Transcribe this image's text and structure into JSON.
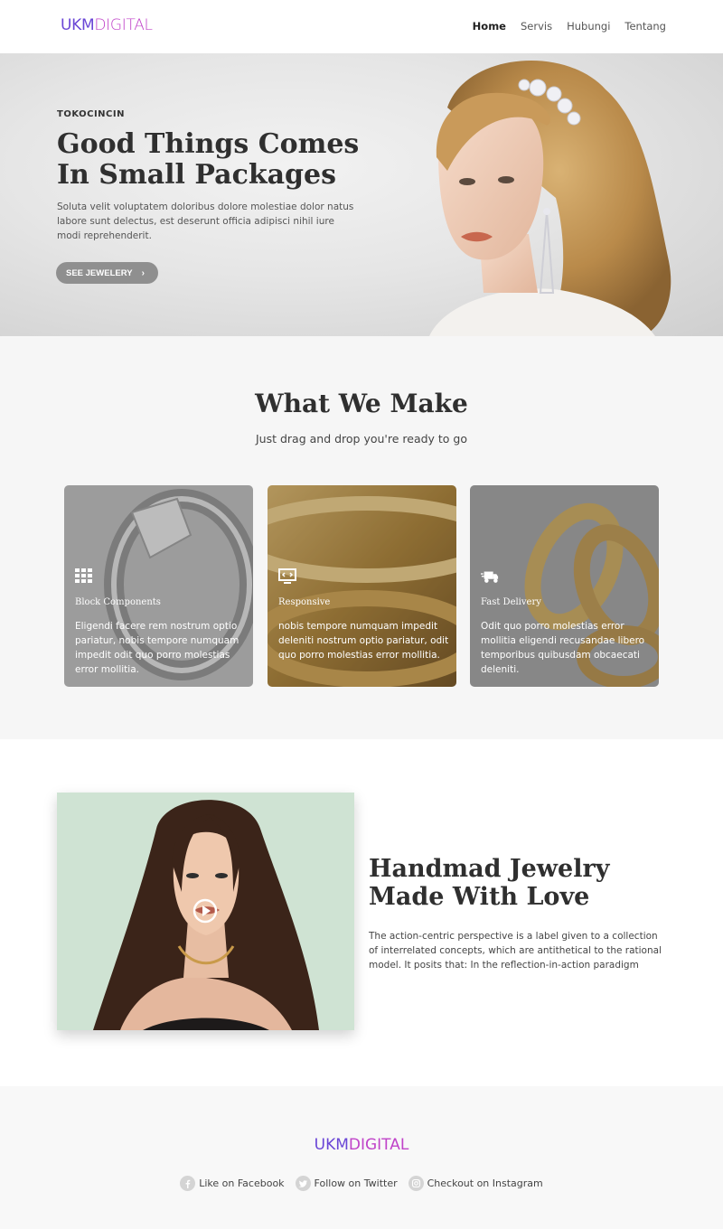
{
  "nav": {
    "logo_primary": "UKM",
    "logo_secondary": "DIGITAL",
    "links": [
      "Home",
      "Servis",
      "Hubungi",
      "Tentang"
    ]
  },
  "hero": {
    "kicker": "TOKOCINCIN",
    "title": "Good Things Comes In Small Packages",
    "text": "Soluta velit voluptatem doloribus dolore molestiae dolor natus labore sunt delectus, est deserunt officia adipisci nihil iure modi reprehenderit.",
    "button_label": "SEE JEWELERY"
  },
  "what_we_make": {
    "title": "What We Make",
    "subtitle": "Just drag and drop you're ready to go",
    "cards": [
      {
        "icon": "grid-icon",
        "title": "Block Components",
        "text": "Eligendi facere rem nostrum optio pariatur, nobis tempore numquam impedit odit quo porro molestias error mollitia."
      },
      {
        "icon": "monitor-code-icon",
        "title": "Responsive",
        "text": "nobis tempore numquam impedit deleniti nostrum optio pariatur, odit quo porro molestias error mollitia."
      },
      {
        "icon": "truck-icon",
        "title": "Fast Delivery",
        "text": "Odit quo porro molestias error mollitia eligendi recusandae libero temporibus quibusdam obcaecati deleniti."
      }
    ]
  },
  "handmade": {
    "title": "Handmad Jewelry Made With Love",
    "text": "The action-centric perspective is a label given to a collection of interrelated concepts, which are antithetical to the rational model. It posits that: In the reflection-in-action paradigm"
  },
  "footer": {
    "logo_primary": "UKM",
    "logo_secondary": "DIGITAL",
    "social": [
      {
        "icon": "facebook-icon",
        "label": "Like on Facebook"
      },
      {
        "icon": "twitter-icon",
        "label": "Follow on Twitter"
      },
      {
        "icon": "instagram-icon",
        "label": "Checkout on Instagram"
      }
    ]
  },
  "colors": {
    "logo_primary": "#6a46d6",
    "logo_secondary": "#c043c9",
    "hero_button": "#8f8f8f",
    "heading": "#2f2f2f"
  }
}
